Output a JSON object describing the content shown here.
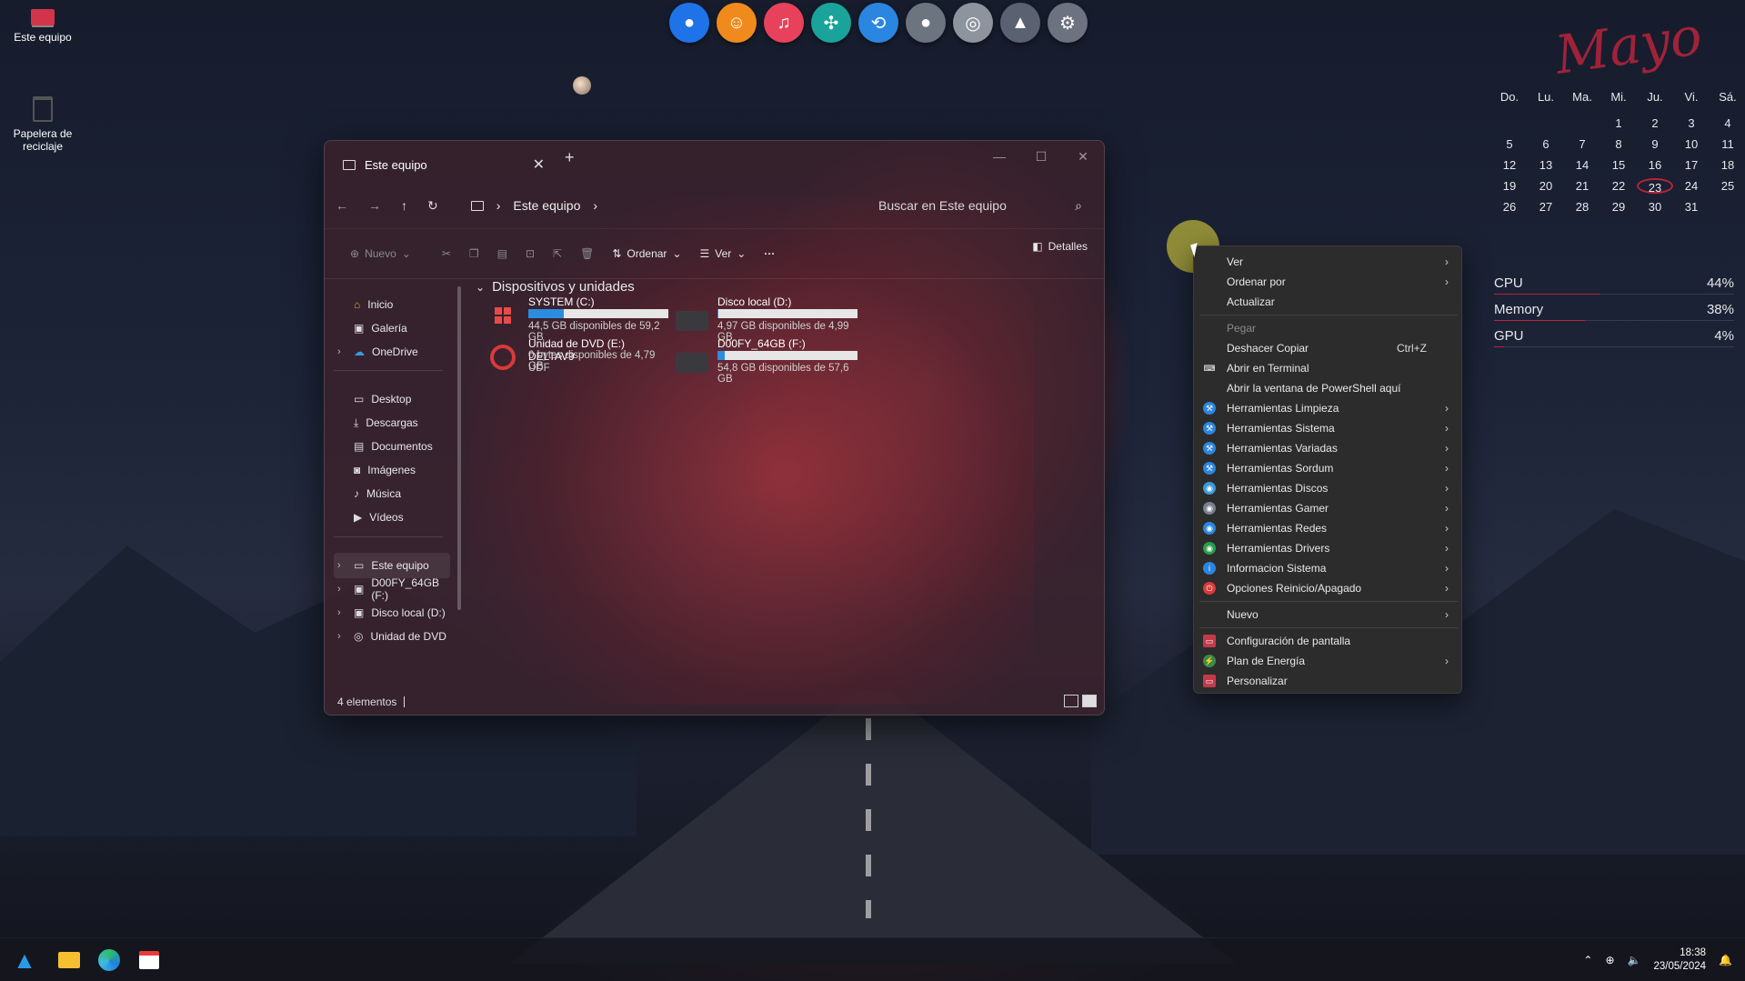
{
  "desktop": {
    "icons": [
      {
        "label": "Este equipo",
        "icon": "monitor-icon"
      },
      {
        "label": "Papelera de reciclaje",
        "icon": "recycle-bin-icon"
      }
    ]
  },
  "dock": {
    "items": [
      {
        "icon": "blue-orb-icon",
        "color": "#1e73e8"
      },
      {
        "icon": "odnoklassniki-icon",
        "color": "#f08a1c"
      },
      {
        "icon": "music-icon",
        "color": "#e8415c"
      },
      {
        "icon": "dots-flower-icon",
        "color": "#1aa39a"
      },
      {
        "icon": "share-icon",
        "color": "#2a86e0"
      },
      {
        "icon": "droplet-icon",
        "color": "#6c7480"
      },
      {
        "icon": "disc-icon",
        "color": "#8d949e"
      },
      {
        "icon": "rocket-icon",
        "color": "#5a6170"
      },
      {
        "icon": "settings-icon",
        "color": "#6c7280"
      }
    ]
  },
  "calendar": {
    "month": "Mayo",
    "weekdays": [
      "Do.",
      "Lu.",
      "Ma.",
      "Mi.",
      "Ju.",
      "Vi.",
      "Sá."
    ],
    "weeks": [
      [
        "",
        "",
        "",
        "1",
        "2",
        "3",
        "4"
      ],
      [
        "5",
        "6",
        "7",
        "8",
        "9",
        "10",
        "11"
      ],
      [
        "12",
        "13",
        "14",
        "15",
        "16",
        "17",
        "18"
      ],
      [
        "19",
        "20",
        "21",
        "22",
        "23",
        "24",
        "25"
      ],
      [
        "26",
        "27",
        "28",
        "29",
        "30",
        "31",
        ""
      ]
    ],
    "today": "23",
    "accent": "#b8243c"
  },
  "performance": [
    {
      "label": "CPU",
      "value": "44%",
      "fraction": 0.44
    },
    {
      "label": "Memory",
      "value": "38%",
      "fraction": 0.38
    },
    {
      "label": "GPU",
      "value": "4%",
      "fraction": 0.04
    }
  ],
  "explorer": {
    "tab_title": "Este equipo",
    "breadcrumb": [
      "Este equipo"
    ],
    "search_placeholder": "Buscar en Este equipo",
    "toolbar": {
      "new_label": "Nuevo",
      "sort_label": "Ordenar",
      "view_label": "Ver",
      "more_label": "···",
      "details_label": "Detalles"
    },
    "nav": {
      "items": [
        {
          "label": "Inicio",
          "icon": "home-icon"
        },
        {
          "label": "Galería",
          "icon": "gallery-icon"
        },
        {
          "label": "OneDrive",
          "icon": "cloud-icon",
          "expandable": true
        },
        {
          "label": "Desktop",
          "icon": "folder-icon"
        },
        {
          "label": "Descargas",
          "icon": "download-icon"
        },
        {
          "label": "Documentos",
          "icon": "document-icon"
        },
        {
          "label": "Imágenes",
          "icon": "image-icon"
        },
        {
          "label": "Música",
          "icon": "music-note-icon"
        },
        {
          "label": "Vídeos",
          "icon": "video-icon"
        },
        {
          "label": "Este equipo",
          "icon": "monitor-icon",
          "expandable": true,
          "selected": true
        },
        {
          "label": "D00FY_64GB (F:)",
          "icon": "drive-icon",
          "expandable": true
        },
        {
          "label": "Disco local (D:)",
          "icon": "drive-icon",
          "expandable": true
        },
        {
          "label": "Unidad de DVD",
          "icon": "dvd-icon",
          "expandable": true
        }
      ]
    },
    "section_title": "Dispositivos y unidades",
    "drives": [
      {
        "name": "SYSTEM (C:)",
        "space": "44,5 GB disponibles de 59,2 GB",
        "used_fraction": 0.25,
        "icon": "windows-drive-icon"
      },
      {
        "name": "Disco local (D:)",
        "space": "4,97 GB disponibles de 4,99 GB",
        "used_fraction": 0.004,
        "icon": "hdd-icon"
      },
      {
        "name": "Unidad de DVD (E:) DELTAV9",
        "space": "0 bytes disponibles de 4,79 GB",
        "extra": "UDF",
        "icon": "dvd-disc-icon"
      },
      {
        "name": "D00FY_64GB (F:)",
        "space": "54,8 GB disponibles de 57,6 GB",
        "used_fraction": 0.05,
        "icon": "hdd-icon"
      }
    ],
    "status": "4 elementos"
  },
  "context_menu": {
    "items": [
      {
        "label": "Ver",
        "submenu": true
      },
      {
        "label": "Ordenar por",
        "submenu": true
      },
      {
        "label": "Actualizar"
      },
      {
        "sep": true
      },
      {
        "label": "Pegar",
        "disabled": true
      },
      {
        "label": "Deshacer Copiar",
        "shortcut": "Ctrl+Z"
      },
      {
        "label": "Abrir en Terminal",
        "icon": "terminal-icon"
      },
      {
        "label": "Abrir la ventana de PowerShell aquí"
      },
      {
        "label": "Herramientas Limpieza",
        "submenu": true,
        "icon": "tools-icon",
        "color": "#2a86e0"
      },
      {
        "label": "Herramientas Sistema",
        "submenu": true,
        "icon": "tools-icon",
        "color": "#2a86e0"
      },
      {
        "label": "Herramientas Variadas",
        "submenu": true,
        "icon": "tools-icon",
        "color": "#2a86e0"
      },
      {
        "label": "Herramientas Sordum",
        "submenu": true,
        "icon": "tools-icon",
        "color": "#2a86e0"
      },
      {
        "label": "Herramientas Discos",
        "submenu": true,
        "icon": "disk-tool-icon",
        "color": "#3a9ad8"
      },
      {
        "label": "Herramientas Gamer",
        "submenu": true,
        "icon": "gamer-icon",
        "color": "#7a8090"
      },
      {
        "label": "Herramientas Redes",
        "submenu": true,
        "icon": "network-icon",
        "color": "#2a86e0"
      },
      {
        "label": "Herramientas Drivers",
        "submenu": true,
        "icon": "driver-icon",
        "color": "#27a04c"
      },
      {
        "label": "Informacion Sistema",
        "submenu": true,
        "icon": "info-icon",
        "color": "#2a86e0"
      },
      {
        "label": "Opciones Reinicio/Apagado",
        "submenu": true,
        "icon": "power-icon",
        "color": "#d83a3a"
      },
      {
        "sep": true
      },
      {
        "label": "Nuevo",
        "submenu": true
      },
      {
        "sep": true
      },
      {
        "label": "Configuración de pantalla",
        "icon": "display-icon",
        "color": "#c43a4a"
      },
      {
        "label": "Plan de Energía",
        "submenu": true,
        "icon": "energy-icon",
        "color": "#3a8a4a"
      },
      {
        "label": "Personalizar",
        "icon": "personalize-icon",
        "color": "#c43a4a"
      }
    ]
  },
  "taskbar": {
    "apps": [
      {
        "icon": "start-triangle-icon"
      },
      {
        "icon": "file-explorer-icon"
      },
      {
        "icon": "edge-icon"
      },
      {
        "icon": "store-icon"
      }
    ],
    "time": "18:38",
    "date": "23/05/2024"
  }
}
